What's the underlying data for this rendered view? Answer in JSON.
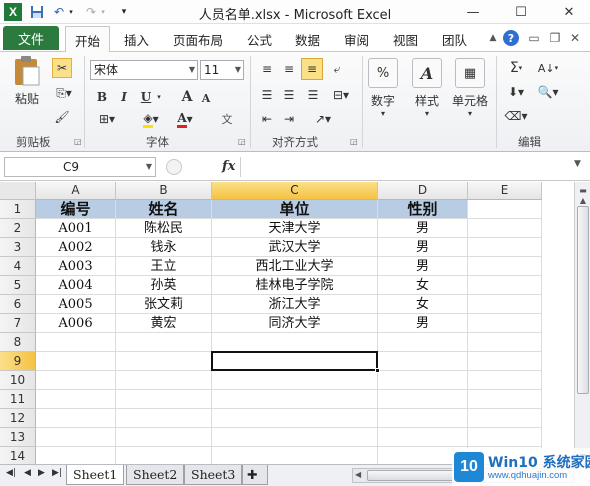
{
  "window": {
    "title": "人员名单.xlsx - Microsoft Excel",
    "minimize": "—",
    "maximize": "☐",
    "close": "✕"
  },
  "quick_access": {
    "save_icon": "save-icon",
    "undo": "↶",
    "redo": "↷",
    "customize": "▾"
  },
  "tabs": {
    "file": "文件",
    "items": [
      "开始",
      "插入",
      "页面布局",
      "公式",
      "数据",
      "审阅",
      "视图",
      "团队"
    ],
    "active_index": 0
  },
  "ribbon": {
    "clipboard": {
      "paste": "粘贴",
      "label": "剪贴板"
    },
    "font": {
      "name": "宋体",
      "size": "11",
      "bold": "B",
      "italic": "I",
      "underline": "U",
      "grow": "A",
      "shrink": "A",
      "font_color": "A",
      "label": "字体"
    },
    "alignment": {
      "label": "对齐方式"
    },
    "number": {
      "button": "数字",
      "symbol": "%"
    },
    "styles": {
      "button": "样式",
      "symbol": "A"
    },
    "cells": {
      "button": "单元格"
    },
    "editing": {
      "label": "编辑",
      "sum": "Σ",
      "sort": "A↓"
    }
  },
  "formula_bar": {
    "name_box": "C9",
    "fx": "fx",
    "value": ""
  },
  "sheet": {
    "columns": [
      "A",
      "B",
      "C",
      "D",
      "E"
    ],
    "selected_column": "C",
    "rows": [
      "1",
      "2",
      "3",
      "4",
      "5",
      "6",
      "7",
      "8",
      "9",
      "10",
      "11",
      "12",
      "13",
      "14"
    ],
    "selected_row": "9",
    "header": [
      "编号",
      "姓名",
      "单位",
      "性别"
    ],
    "header_fill": "#b8cce4",
    "data": [
      [
        "A001",
        "陈松民",
        "天津大学",
        "男"
      ],
      [
        "A002",
        "钱永",
        "武汉大学",
        "男"
      ],
      [
        "A003",
        "王立",
        "西北工业大学",
        "男"
      ],
      [
        "A004",
        "孙英",
        "桂林电子学院",
        "女"
      ],
      [
        "A005",
        "张文莉",
        "浙江大学",
        "女"
      ],
      [
        "A006",
        "黄宏",
        "同济大学",
        "男"
      ]
    ]
  },
  "sheet_tabs": [
    "Sheet1",
    "Sheet2",
    "Sheet3"
  ],
  "active_sheet": "Sheet1",
  "watermark": {
    "logo": "10",
    "title": "Win10 系统家园",
    "url": "www.qdhuajin.com"
  }
}
